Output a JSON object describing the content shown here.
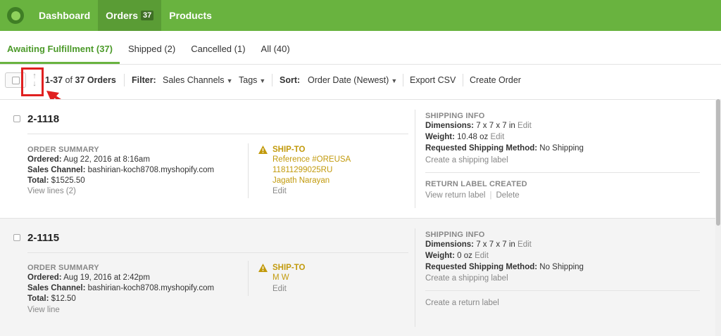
{
  "nav": {
    "items": [
      {
        "label": "Dashboard"
      },
      {
        "label": "Orders",
        "badge": "37"
      },
      {
        "label": "Products"
      }
    ],
    "color": "#69b33f"
  },
  "tabs": [
    {
      "label": "Awaiting Fulfillment (37)"
    },
    {
      "label": "Shipped (2)"
    },
    {
      "label": "Cancelled (1)"
    },
    {
      "label": "All (40)"
    }
  ],
  "toolbar": {
    "range": "1-37",
    "of": "of",
    "total": "37 Orders",
    "filter_label": "Filter:",
    "sales_channels": "Sales Channels",
    "tags": "Tags",
    "sort_label": "Sort:",
    "sort_value": "Order Date (Newest)",
    "export": "Export CSV",
    "create_order": "Create Order"
  },
  "orders": [
    {
      "number": "2-1118",
      "summary_label": "ORDER SUMMARY",
      "ordered_k": "Ordered:",
      "ordered_v": "Aug 22, 2016 at 8:16am",
      "channel_k": "Sales Channel:",
      "channel_v": "bashirian-koch8708.myshopify.com",
      "total_k": "Total:",
      "total_v": "$1525.50",
      "view_lines": "View lines (2)",
      "shipto_label": "SHIP-TO",
      "shipto_lines": [
        "Reference #OREUSA",
        "11811299025RU",
        "Jagath Narayan"
      ],
      "shipto_edit": "Edit",
      "shipping_info_label": "SHIPPING INFO",
      "dim_k": "Dimensions:",
      "dim_v": "7 x 7 x 7 in",
      "dim_edit": "Edit",
      "weight_k": "Weight:",
      "weight_v": "10.48 oz",
      "weight_edit": "Edit",
      "method_k": "Requested Shipping Method:",
      "method_v": "No Shipping",
      "create_label": "Create a shipping label",
      "return_label_title": "RETURN LABEL CREATED",
      "view_return": "View return label",
      "delete": "Delete"
    },
    {
      "number": "2-1115",
      "summary_label": "ORDER SUMMARY",
      "ordered_k": "Ordered:",
      "ordered_v": "Aug 19, 2016 at 2:42pm",
      "channel_k": "Sales Channel:",
      "channel_v": "bashirian-koch8708.myshopify.com",
      "total_k": "Total:",
      "total_v": "$12.50",
      "view_lines": "View line",
      "shipto_label": "SHIP-TO",
      "shipto_lines": [
        "M W"
      ],
      "shipto_edit": "Edit",
      "shipping_info_label": "SHIPPING INFO",
      "dim_k": "Dimensions:",
      "dim_v": "7 x 7 x 7 in",
      "dim_edit": "Edit",
      "weight_k": "Weight:",
      "weight_v": "0 oz",
      "weight_edit": "Edit",
      "method_k": "Requested Shipping Method:",
      "method_v": "No Shipping",
      "create_label": "Create a shipping label",
      "create_return": "Create a return label"
    }
  ]
}
